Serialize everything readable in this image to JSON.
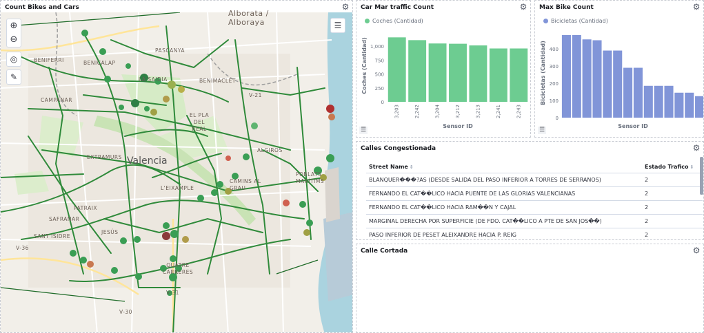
{
  "map_panel": {
    "title": "Count Bikes and Cars",
    "zoom_in_icon": "plus-icon",
    "zoom_out_icon": "minus-icon",
    "labels": {
      "city": "Valencia",
      "alboraya": "Alboraya",
      "alboraya_alt": "Alborata /",
      "benicalap": "BENICALAP",
      "beniferri": "BENIFERRI",
      "campanar": "CAMPANAR",
      "pascanya": "PASCANYA",
      "la_saidia": "LA SAIDIA",
      "benimaclet": "BENIMACLET",
      "el_pla_del_real": "EL PLA DEL REAL",
      "extramurs": "EXTRAMURS",
      "algiros": "ALGIROS",
      "l_eixample": "L'EIXAMPLE",
      "camins_grau": "CAMINS AL GRAU",
      "poblats_maritims": "POBLATS MARÍTIMS",
      "patraix": "PATRAIX",
      "safranar": "SAFRANAR",
      "jesus": "JESÚS",
      "sant_isidre": "SANT ISIDRE",
      "quatre_carreres": "QUATRE CARRERES",
      "v21": "V-21",
      "v30": "V-30",
      "v36": "V-36",
      "v31": "V-31"
    }
  },
  "car_chart": {
    "title": "Car Mar traffic Count",
    "legend": "Coches (Cantidad)",
    "xlabel": "Sensor ID",
    "ylabel": "Coches (Cantidad)",
    "color": "#6dcc91"
  },
  "bike_chart": {
    "title": "Max Bike Count",
    "legend": "Bicicletas (Cantidad)",
    "xlabel": "Sensor ID",
    "ylabel": "Bicicletas (Cantidad)",
    "color": "#8195d8"
  },
  "chart_data": [
    {
      "type": "bar",
      "title": "Car Mar traffic Count",
      "categories": [
        "3,203",
        "2,242",
        "3,204",
        "3,212",
        "3,213",
        "2,241",
        "2,243"
      ],
      "series": [
        {
          "name": "Coches (Cantidad)",
          "values": [
            1160,
            1110,
            1050,
            1045,
            1015,
            960,
            960
          ]
        }
      ],
      "xlabel": "Sensor ID",
      "ylabel": "Coches (Cantidad)",
      "ylim": [
        0,
        1300
      ],
      "yticks": [
        0,
        250,
        500,
        750,
        "1,000"
      ],
      "grid": false,
      "legend": "top-left"
    },
    {
      "type": "bar",
      "title": "Max Bike Count",
      "categories": [
        "",
        "",
        "",
        "",
        "",
        "",
        "",
        "",
        "",
        "",
        "",
        "",
        "",
        ""
      ],
      "series": [
        {
          "name": "Bicicletas (Cantidad)",
          "values": [
            480,
            480,
            455,
            450,
            390,
            390,
            290,
            290,
            185,
            185,
            185,
            145,
            145,
            125
          ]
        }
      ],
      "xlabel": "Sensor ID",
      "ylabel": "Bicicletas (Cantidad)",
      "ylim": [
        0,
        520
      ],
      "yticks": [
        0,
        100,
        200,
        300,
        400
      ],
      "grid": false,
      "legend": "top-left"
    }
  ],
  "table_panel": {
    "title": "Calles Congestionada",
    "col_street": "Street Name",
    "col_estado": "Estado Trafico",
    "rows": [
      {
        "street": "BLANQUER���?AS (DESDE SALIDA DEL PASO INFERIOR A TORRES DE SERRANOS)",
        "estado": "2"
      },
      {
        "street": "FERNANDO EL CAT��LICO HACIA PUENTE DE LAS GLORIAS VALENCIANAS",
        "estado": "2"
      },
      {
        "street": "FERNANDO EL CAT��LICO HACIA RAM��N Y CAJAL",
        "estado": "2"
      },
      {
        "street": "MARGINAL DERECHA POR SUPERFICIE (DE FDO. CAT��LICO A PTE DE SAN JOS��)",
        "estado": "2"
      },
      {
        "street": "PASO INFERIOR DE PESET ALEIXANDRE HACIA P. REIG",
        "estado": "2"
      }
    ]
  },
  "cortada_panel": {
    "title": "Calle Cortada"
  },
  "icons": {
    "gear": "gear-icon",
    "list": "list-icon",
    "layers": "layers-icon",
    "locate": "locate-icon",
    "measure": "measure-icon"
  }
}
